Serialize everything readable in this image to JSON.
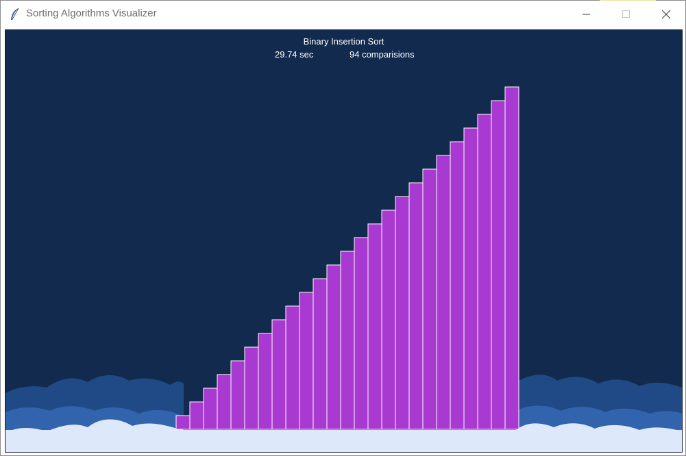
{
  "window": {
    "title": "Sorting Algorithms Visualizer",
    "icon": "feather-icon",
    "controls": [
      "minimize-icon",
      "maximize-icon",
      "close-icon"
    ]
  },
  "canvas": {
    "algorithm_title": "Binary Insertion Sort",
    "time": "29.74 sec",
    "comparisons": "94 comparisions"
  },
  "colors": {
    "background": "#122a4d",
    "bar_fill": "#a93ad1",
    "bar_stroke": "#ffffff",
    "cloud_dark": "#24508f",
    "cloud_mid": "#3768b3",
    "cloud_light": "#dde9fb"
  },
  "chart_data": {
    "type": "bar",
    "sorted": true,
    "values": [
      1,
      2,
      3,
      4,
      5,
      6,
      7,
      8,
      9,
      10,
      11,
      12,
      13,
      14,
      15,
      16,
      17,
      18,
      19,
      20,
      21,
      22,
      23,
      24,
      25
    ]
  }
}
